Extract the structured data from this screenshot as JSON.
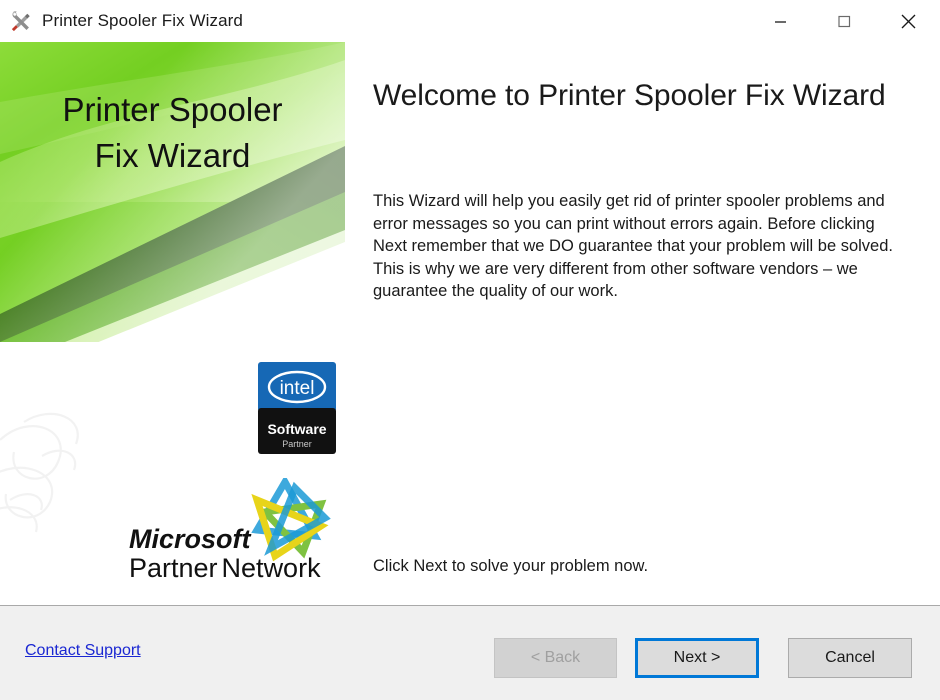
{
  "window": {
    "title": "Printer Spooler Fix Wizard",
    "icon": "wrench-screwdriver-icon",
    "controls": {
      "minimize": "minimize-icon",
      "maximize": "maximize-icon",
      "close": "close-icon"
    }
  },
  "banner": {
    "title_line1": "Printer Spooler",
    "title_line2": "Fix Wizard",
    "colors": {
      "green_light": "#a4e04a",
      "green_mid": "#6ec81e",
      "green_bright": "#76cf1f",
      "green_dark": "#2f6b0c",
      "green_pale": "#d8f2a8"
    }
  },
  "main": {
    "headline": "Welcome to Printer Spooler Fix Wizard",
    "body": "This Wizard will help you easily get rid of printer spooler problems and error messages so you can print without errors again. Before clicking Next remember that we DO guarantee that your problem will be solved. This is why we are very different from other software vendors – we guarantee the quality of our work.",
    "click_next": "Click Next to solve your problem now."
  },
  "logos": {
    "intel": {
      "name": "intel-software-partner-logo",
      "wordmark": "intel",
      "line1": "Software",
      "line2": "Partner",
      "top_color": "#1668b5",
      "bottom_color": "#111111"
    },
    "microsoft": {
      "name": "microsoft-partner-network-logo",
      "line1": "Microsoft",
      "line2_a": "Partner",
      "line2_b": "Network",
      "star_colors": [
        "#3ea9dd",
        "#7fc241",
        "#e8d41a",
        "#1b9ad6",
        "#9ccb3b"
      ]
    }
  },
  "footer": {
    "support_link": "Contact Support",
    "link_color": "#1a27d2",
    "buttons": {
      "back": {
        "label": "< Back",
        "enabled": false
      },
      "next": {
        "label": "Next >",
        "enabled": true,
        "focused": true,
        "focus_color": "#0078d7"
      },
      "cancel": {
        "label": "Cancel",
        "enabled": true
      }
    }
  }
}
